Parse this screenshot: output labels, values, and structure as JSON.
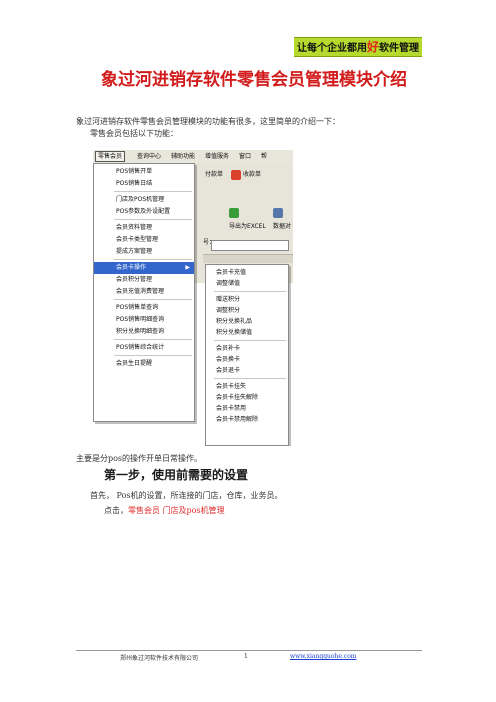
{
  "header": {
    "banner_pre": "让每个企业都用",
    "banner_hl": "好",
    "banner_post": "软件管理"
  },
  "title": "象过河进销存软件零售会员管理模块介绍",
  "intro": "象过河进销存软件零售会员管理模块的功能有很多，这里简单的介绍一下：",
  "intro2": "零售会员包括以下功能：",
  "screenshot": {
    "menubar": [
      "零售会员",
      "查询中心",
      "辅助功能",
      "增值服务",
      "窗口",
      "帮"
    ],
    "toolbar": [
      "付款单",
      "收款单",
      "导出为EXCEL",
      "数据对"
    ],
    "field_label": "号：",
    "menu_items": [
      "POS销售开单",
      "POS销售日结",
      "门店及POS机管理",
      "POS参数及外设配置",
      "会员资料管理",
      "会员卡类型管理",
      "提成方案管理",
      "会员卡操作",
      "会员积分管理",
      "会员充值消费管理",
      "POS销售单查询",
      "POS销售明细查询",
      "积分兑换明细查询",
      "POS销售综合统计",
      "会员生日提醒"
    ],
    "submenu_items": [
      "会员卡充值",
      "调整储值",
      "赠送积分",
      "调整积分",
      "积分兑换礼品",
      "积分兑换储值",
      "会员补卡",
      "会员换卡",
      "会员退卡",
      "会员卡挂失",
      "会员卡挂失解除",
      "会员卡禁用",
      "会员卡禁用解除"
    ]
  },
  "after_shot": "主要是分pos的操作开单日常操作。",
  "step1": "第一步，使用前需要的设置",
  "p_first": "首先，   Pos机的设置，所连接的门店，仓库，业务员。",
  "p_click_label": "点击，",
  "p_click_path": "零售会员  门店及pos机管理",
  "footer": {
    "company": "郑州象过河软件技术有限公司",
    "page": "1",
    "url": "www.xiangguohe.com"
  },
  "colors": {
    "banner_bg": "#b5d92c",
    "title_red": "#d21c1c",
    "menu_highlight": "#3366cc",
    "link_blue": "#1a3fd1"
  }
}
